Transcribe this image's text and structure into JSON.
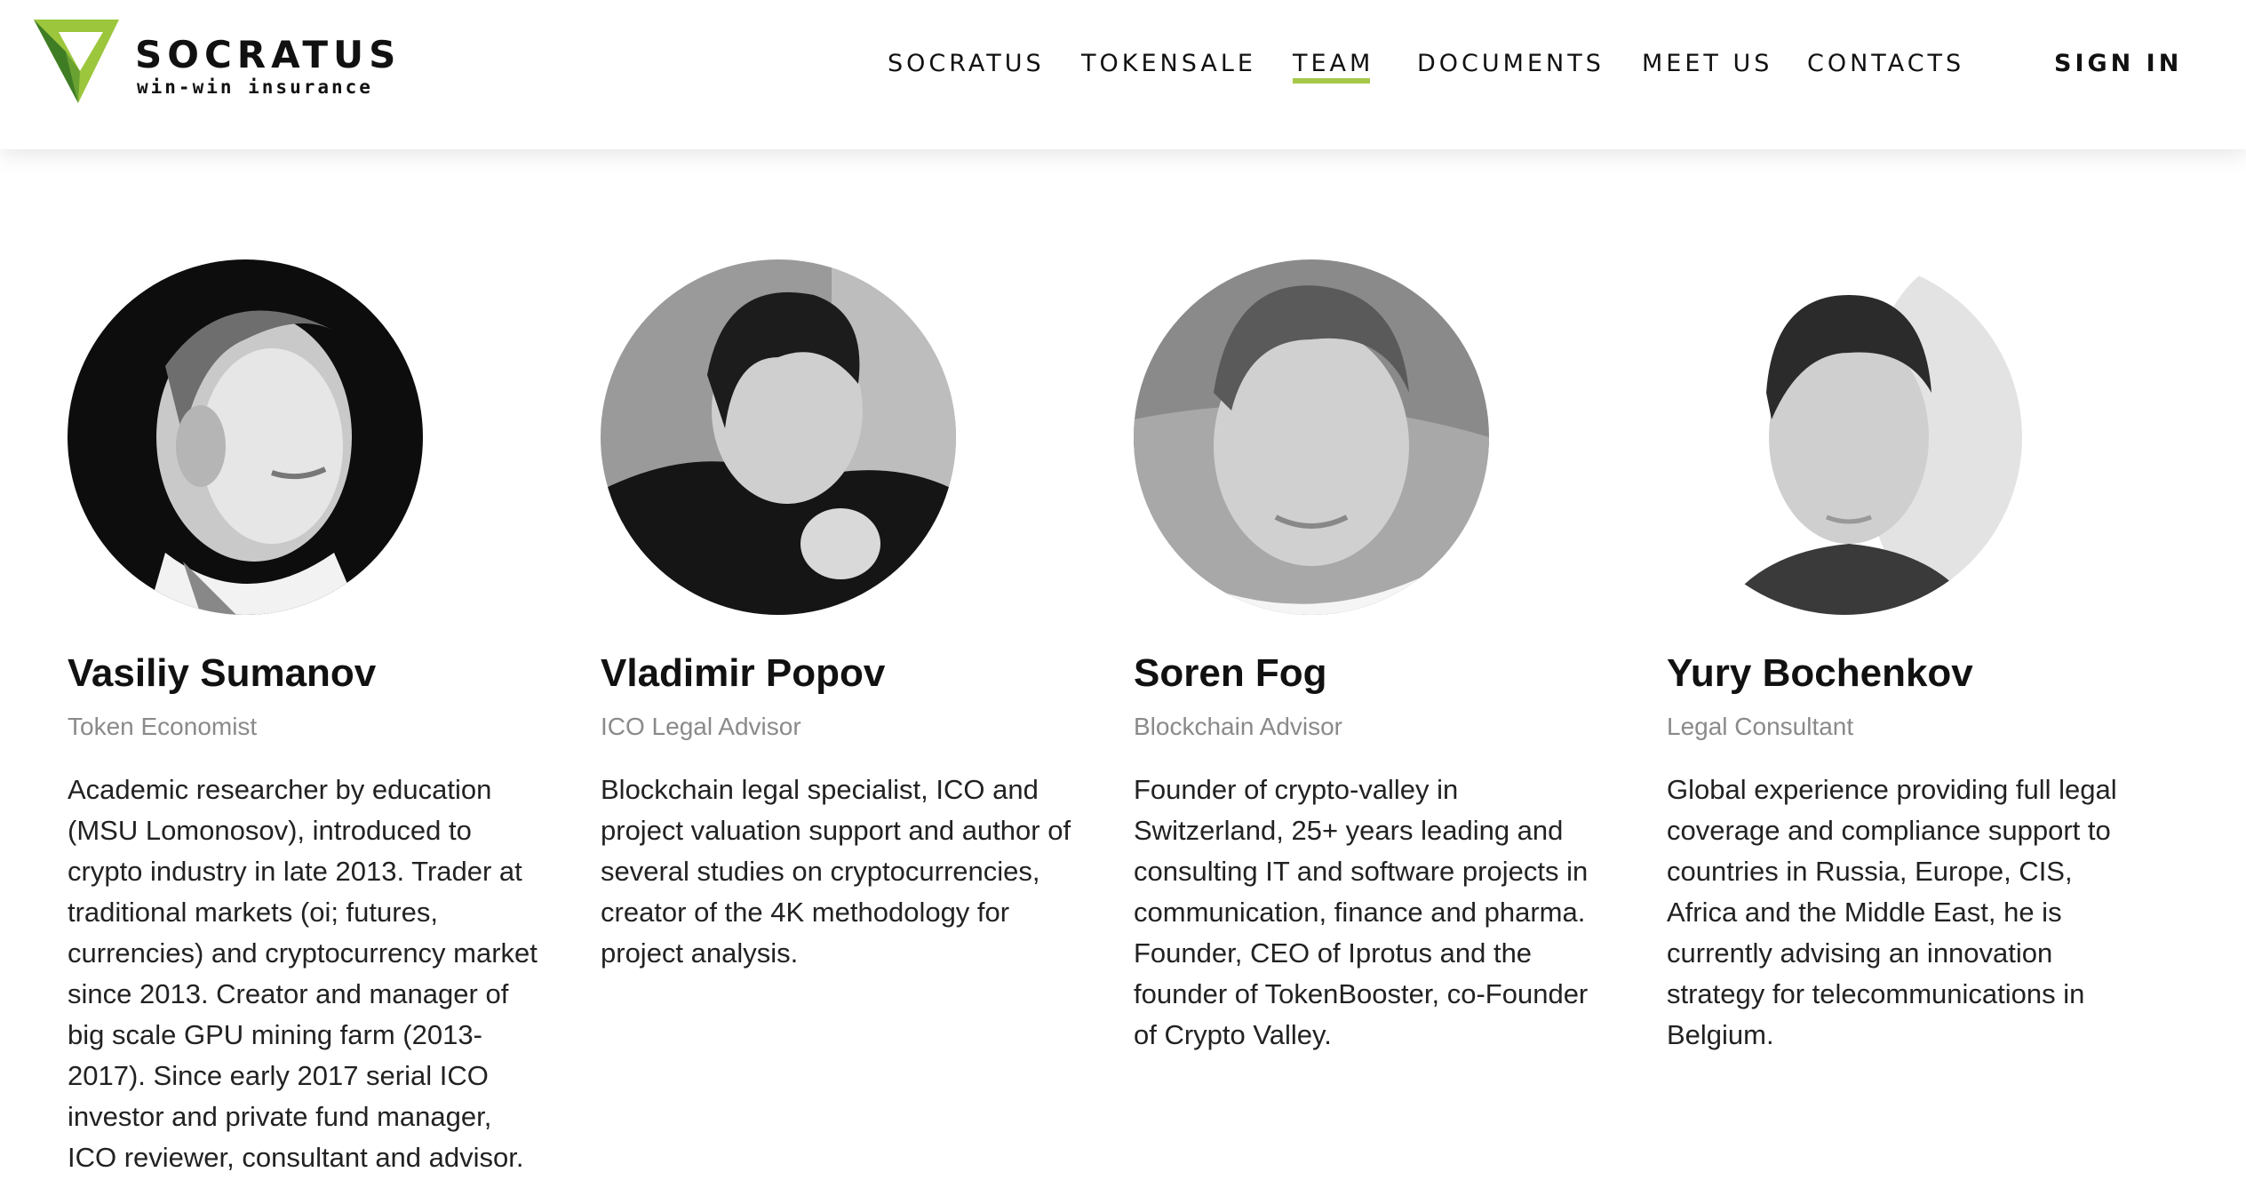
{
  "brand": {
    "name": "SOCRATUS",
    "tagline": "win-win insurance",
    "accent_color": "#a6c84a",
    "logo_dark_green": "#4a8a2a"
  },
  "nav": {
    "items": [
      {
        "label": "SOCRATUS",
        "active": false
      },
      {
        "label": "TOKENSALE",
        "active": false
      },
      {
        "label": "TEAM",
        "active": true
      },
      {
        "label": "DOCUMENTS",
        "active": false
      },
      {
        "label": "MEET US",
        "active": false
      },
      {
        "label": "CONTACTS",
        "active": false
      }
    ],
    "sign_in": "SIGN IN"
  },
  "team": [
    {
      "name": "Vasiliy Sumanov",
      "role": "Token Economist",
      "bio": "Academic researcher by education (MSU Lomonosov), introduced to crypto industry in late 2013. Trader at traditional markets (oi; futures, currencies) and cryptocurrency market since 2013. Creator and manager of big scale GPU mining farm (2013-2017). Since early 2017 serial ICO investor and private fund manager, ICO reviewer, consultant and advisor."
    },
    {
      "name": "Vladimir Popov",
      "role": "ICO Legal Advisor",
      "bio": "Blockchain legal specialist, ICO and project valuation support and author of several studies on cryptocurrencies, creator of the 4K methodology for project analysis."
    },
    {
      "name": "Soren Fog",
      "role": "Blockchain Advisor",
      "bio": "Founder of crypto-valley in Switzerland, 25+ years leading and consulting IT and software projects in communication, finance and pharma. Founder, CEO of Iprotus and the founder of TokenBooster, co-Founder of Crypto Valley."
    },
    {
      "name": "Yury Bochenkov",
      "role": "Legal Consultant",
      "bio": "Global experience providing full legal coverage and compliance support to countries in Russia, Europe, CIS, Africa and the Middle East, he is currently advising an innovation strategy for telecommunications in Belgium."
    }
  ]
}
